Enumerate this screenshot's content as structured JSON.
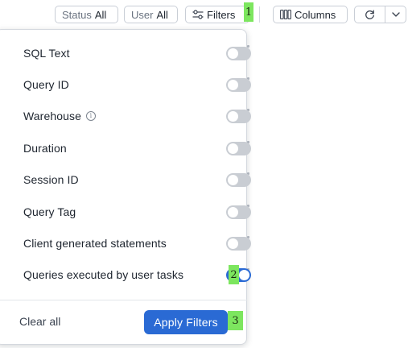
{
  "toolbar": {
    "status_label": "Status",
    "status_value": "All",
    "user_label": "User",
    "user_value": "All",
    "filters_label": "Filters",
    "columns_label": "Columns",
    "refresh_icon": "refresh-icon",
    "dropdown_icon": "chevron-down-icon"
  },
  "badges": {
    "one": "1",
    "two": "2",
    "three": "3"
  },
  "filters": {
    "items": [
      {
        "label": "SQL Text",
        "enabled": false
      },
      {
        "label": "Query ID",
        "enabled": false
      },
      {
        "label": "Warehouse",
        "enabled": false,
        "info_icon": true
      },
      {
        "label": "Duration",
        "enabled": false
      },
      {
        "label": "Session ID",
        "enabled": false
      },
      {
        "label": "Query Tag",
        "enabled": false
      },
      {
        "label": "Client generated statements",
        "enabled": false
      },
      {
        "label": "Queries executed by user tasks",
        "enabled": true
      }
    ],
    "info_symbol": "i",
    "clear_all_label": "Clear all",
    "apply_label": "Apply Filters"
  },
  "colors": {
    "accent": "#2a6ad4",
    "toggle_off": "#c9cdd3",
    "badge": "#7de65f"
  }
}
